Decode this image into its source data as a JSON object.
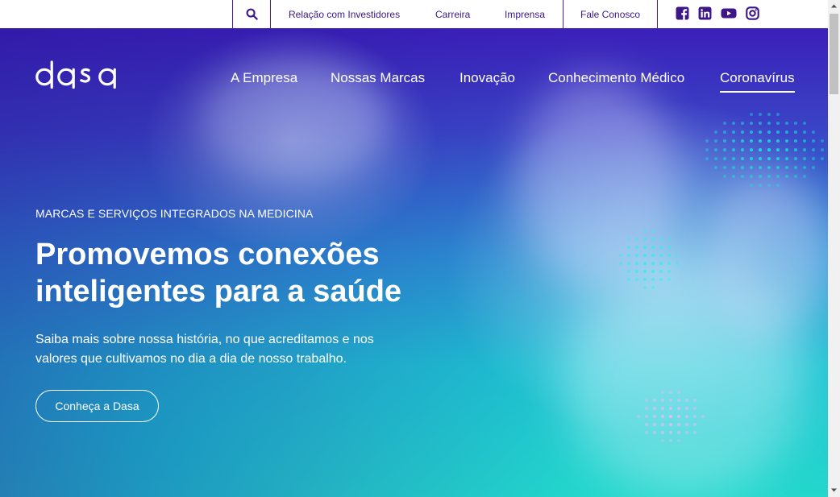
{
  "topbar": {
    "links": [
      {
        "label": "Relação com Investidores"
      },
      {
        "label": "Carreira"
      },
      {
        "label": "Imprensa"
      },
      {
        "label": "Fale Conosco"
      }
    ],
    "social": [
      "facebook-icon",
      "linkedin-icon",
      "youtube-icon",
      "instagram-icon"
    ]
  },
  "brand": {
    "logo_text": "dasa"
  },
  "nav": {
    "items": [
      {
        "label": "A Empresa"
      },
      {
        "label": "Nossas Marcas"
      },
      {
        "label": "Inovação"
      },
      {
        "label": "Conhecimento Médico"
      },
      {
        "label": "Coronavírus"
      }
    ],
    "active": "Coronavírus"
  },
  "hero": {
    "eyebrow": "MARCAS E SERVIÇOS INTEGRADOS NA MEDICINA",
    "title_line1": "Promovemos conexões",
    "title_line2": "inteligentes para a saúde",
    "subtitle": "Saiba mais sobre nossa história, no que acreditamos e nos valores que cultivamos no dia a dia de nosso trabalho.",
    "cta": "Conheça a Dasa"
  },
  "colors": {
    "brand_purple": "#3d1788",
    "hero_top": "#3b1fb9",
    "hero_bottom": "#22d7cc"
  }
}
